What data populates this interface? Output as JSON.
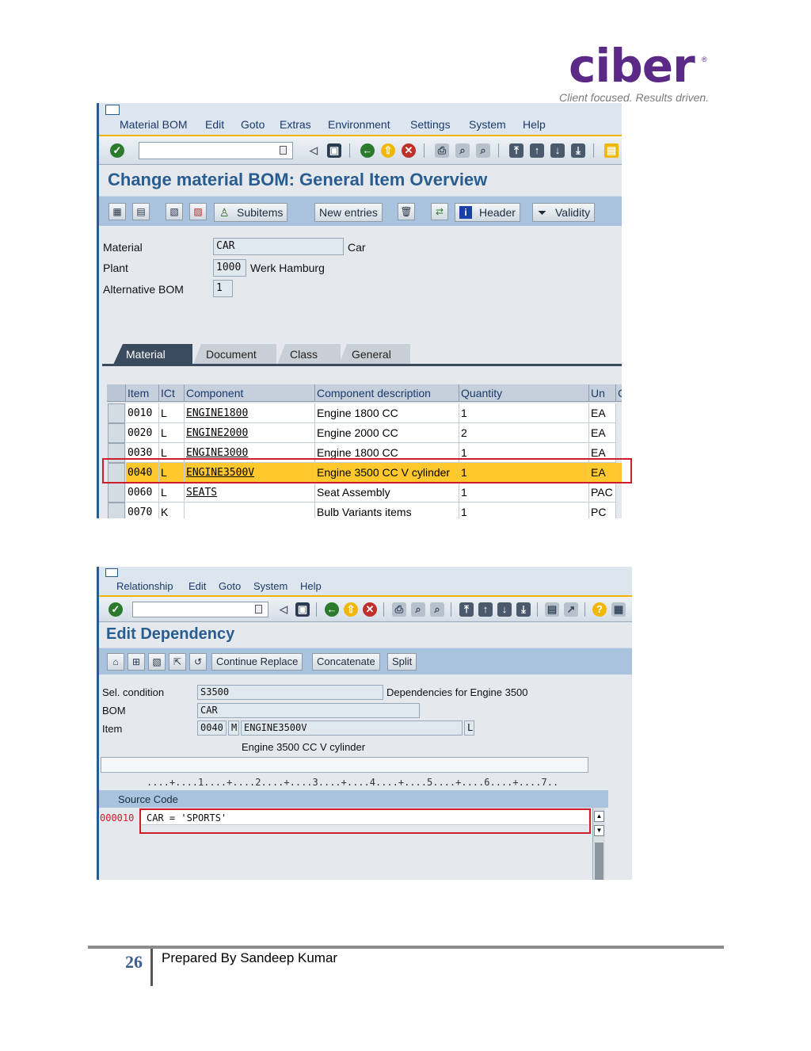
{
  "logo": {
    "word": "ciber",
    "reg": "®",
    "tagline": "Client focused. Results driven."
  },
  "window1": {
    "menu": [
      "Material BOM",
      "Edit",
      "Goto",
      "Extras",
      "Environment",
      "Settings",
      "System",
      "Help"
    ],
    "title": "Change material BOM: General Item Overview",
    "buttons": {
      "subitems": "Subitems",
      "new_entries": "New entries",
      "header": "Header",
      "validity": "Validity"
    },
    "fields": {
      "material_label": "Material",
      "material_value": "CAR",
      "material_desc": "Car",
      "plant_label": "Plant",
      "plant_value": "1000",
      "plant_desc": "Werk Hamburg",
      "altbom_label": "Alternative BOM",
      "altbom_value": "1"
    },
    "tabs": [
      "Material",
      "Document",
      "Class",
      "General"
    ],
    "table": {
      "headers": [
        "Item",
        "ICt",
        "Component",
        "Component description",
        "Quantity",
        "Un",
        "C"
      ],
      "rows": [
        {
          "item": "0010",
          "ict": "L",
          "component": "ENGINE1800",
          "desc": "Engine 1800 CC",
          "qty": "1",
          "un": "EA"
        },
        {
          "item": "0020",
          "ict": "L",
          "component": "ENGINE2000",
          "desc": "Engine 2000 CC",
          "qty": "2",
          "un": "EA"
        },
        {
          "item": "0030",
          "ict": "L",
          "component": "ENGINE3000",
          "desc": "Engine 1800 CC",
          "qty": "1",
          "un": "EA"
        },
        {
          "item": "0040",
          "ict": "L",
          "component": "ENGINE3500V",
          "desc": "Engine 3500 CC V cylinder",
          "qty": "1",
          "un": "EA"
        },
        {
          "item": "0060",
          "ict": "L",
          "component": "SEATS",
          "desc": "Seat Assembly",
          "qty": "1",
          "un": "PAC"
        },
        {
          "item": "0070",
          "ict": "K",
          "component": "",
          "desc": "Bulb Variants items",
          "qty": "1",
          "un": "PC"
        }
      ]
    }
  },
  "window2": {
    "menu": [
      "Relationship",
      "Edit",
      "Goto",
      "System",
      "Help"
    ],
    "title": "Edit Dependency",
    "buttons": {
      "continue_replace": "Continue Replace",
      "concatenate": "Concatenate",
      "split": "Split"
    },
    "fields": {
      "selcond_label": "Sel. condition",
      "selcond_value": "S3500",
      "selcond_desc": "Dependencies for Engine 3500",
      "bom_label": "BOM",
      "bom_value": "CAR",
      "item_label": "Item",
      "item_no": "0040",
      "item_m": "M",
      "item_comp": "ENGINE3500V",
      "item_l": "L",
      "item_desc": "Engine 3500 CC V cylinder"
    },
    "ruler": "....+....1....+....2....+....3....+....4....+....5....+....6....+....7..",
    "source_label": "Source Code",
    "line_no": "000010",
    "code": "CAR = 'SPORTS'"
  },
  "footer": {
    "page": "26",
    "prepared": "Prepared By Sandeep Kumar"
  }
}
